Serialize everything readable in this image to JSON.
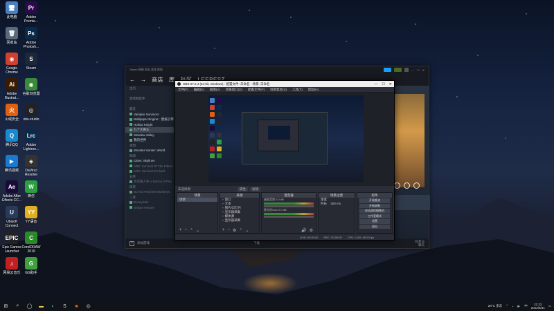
{
  "desktop": {
    "icons": [
      {
        "label": "此电脑",
        "glyph": "🖥",
        "color": "#4a7fc1"
      },
      {
        "label": "Adobe Premie...",
        "glyph": "Pr",
        "color": "#2a0a4a"
      },
      {
        "label": "回收站",
        "glyph": "🗑",
        "color": "#5a6a7a"
      },
      {
        "label": "Adobe Photosh...",
        "glyph": "Ps",
        "color": "#0a2a4a"
      },
      {
        "label": "Google Chrome",
        "glyph": "◉",
        "color": "#d04030"
      },
      {
        "label": "Steam",
        "glyph": "S",
        "color": "#1b2838"
      },
      {
        "label": "Adobe Illustrat...",
        "glyph": "Ai",
        "color": "#3a1a00"
      },
      {
        "label": "谷歌浏览器",
        "glyph": "◉",
        "color": "#3a8a3a"
      },
      {
        "label": "火绒安全",
        "glyph": "火",
        "color": "#e06010"
      },
      {
        "label": "obs-studio",
        "glyph": "◎",
        "color": "#222"
      },
      {
        "label": "腾讯QQ",
        "glyph": "Q",
        "color": "#1a8ad0"
      },
      {
        "label": "Adobe Lightroo...",
        "glyph": "Lrc",
        "color": "#0a2a4a"
      },
      {
        "label": "腾讯视频",
        "glyph": "▶",
        "color": "#1a7ad0"
      },
      {
        "label": "DaVinci Resolve",
        "glyph": "◈",
        "color": "#333"
      },
      {
        "label": "Adobe After Effects CC...",
        "glyph": "Ae",
        "color": "#1a0a3a"
      },
      {
        "label": "微信",
        "glyph": "W",
        "color": "#2aa040"
      },
      {
        "label": "Ubisoft Connect",
        "glyph": "U",
        "color": "#2a3a5a"
      },
      {
        "label": "YY语音",
        "glyph": "YY",
        "color": "#e0b020"
      },
      {
        "label": "Epic Games Launcher",
        "glyph": "EPIC",
        "color": "#222"
      },
      {
        "label": "CorelDRAW 2019",
        "glyph": "C",
        "color": "#2a8a2a"
      },
      {
        "label": "网易云音乐",
        "glyph": "♫",
        "color": "#c02020"
      },
      {
        "label": "GG助手",
        "glyph": "G",
        "color": "#40a040"
      }
    ]
  },
  "steam": {
    "topbar": "Steam   视图   好友   游戏   帮助",
    "nav_store": "商店",
    "nav_library": "库",
    "nav_community": "社区",
    "nav_user": "LEEBEST",
    "sidebar": [
      {
        "label": "主页",
        "type": "hdr"
      },
      {
        "label": "",
        "type": "gap"
      },
      {
        "label": "游戏和软件",
        "type": "hdr"
      },
      {
        "label": "",
        "type": "gap"
      },
      {
        "label": "最近",
        "type": "hdr"
      },
      {
        "label": "Vampire Survivors",
        "type": "game"
      },
      {
        "label": "Wallpaper Engine：壁纸引擎",
        "type": "game"
      },
      {
        "label": "Hollow Knight",
        "type": "game"
      },
      {
        "label": "九个大骨头",
        "type": "sel"
      },
      {
        "label": "Stardew Valley",
        "type": "game"
      },
      {
        "label": "我的世界",
        "type": "game"
      },
      {
        "label": "本周",
        "type": "hdr"
      },
      {
        "label": "Monster Hunter: World",
        "type": "game"
      },
      {
        "label": "四周",
        "type": "hdr"
      },
      {
        "label": "Cities: Skylines",
        "type": "game"
      },
      {
        "label": "ARK: Survival Of The Fittest",
        "type": "dim"
      },
      {
        "label": "ARK: Survival Evolved",
        "type": "dim"
      },
      {
        "label": "五月",
        "type": "hdr"
      },
      {
        "label": "太空狼人杀 A Dance of Fire",
        "type": "dim"
      },
      {
        "label": "四月",
        "type": "hdr"
      },
      {
        "label": "Do Not Feed the Monkeys",
        "type": "dim"
      },
      {
        "label": "二月",
        "type": "hdr"
      },
      {
        "label": "Bunnyrider",
        "type": "dim"
      },
      {
        "label": "Deluxe Heroes",
        "type": "dim"
      }
    ],
    "bottom_add": "添加游戏",
    "bottom_mid": "下载",
    "bottom_right_1": "好友与",
    "bottom_right_2": "聊天"
  },
  "obs": {
    "title": "OBS 27.2.4 (64-bit, windows) - 配置文件: 未命名 - 场景: 未命名",
    "min": "—",
    "max": "☐",
    "close": "✕",
    "menu": [
      "文件(F)",
      "编辑(E)",
      "视图(V)",
      "停靠窗口(D)",
      "配置文件(P)",
      "场景集合(S)",
      "工具(T)",
      "帮助(H)"
    ],
    "scene_header": "未选择源",
    "prop_btn": "属性",
    "filter_btn": "滤镜",
    "docks": {
      "scenes": {
        "title": "场景",
        "items": [
          "场景"
        ]
      },
      "sources": {
        "title": "来源",
        "items": [
          "窗口",
          "文本",
          "图片/幻灯片",
          "显示器采集",
          "媒体源",
          "显示器采集"
        ]
      },
      "mixer": {
        "title": "混音器",
        "items": [
          {
            "name": "桌面音频",
            "db": "0.0 dB"
          },
          {
            "name": "麦克风/Aux",
            "db": "0.0 dB"
          }
        ]
      },
      "transitions": {
        "title": "场景过渡",
        "type": "渐变",
        "duration_label": "时长",
        "duration": "300 ms"
      },
      "controls": {
        "title": "控件",
        "buttons": [
          "开始推流",
          "开始录制",
          "启动虚拟摄像机",
          "工作室模式",
          "设置",
          "退出"
        ]
      }
    },
    "status": [
      "LIVE: 00:00:00",
      "REC: 00:00:00",
      "CPU: 2.4%, 60.00 fps"
    ]
  },
  "taskbar": {
    "start": "⊞",
    "weather": "28°C 多云",
    "time": "21:22",
    "date": "2022/8/31",
    "lang": "中"
  }
}
